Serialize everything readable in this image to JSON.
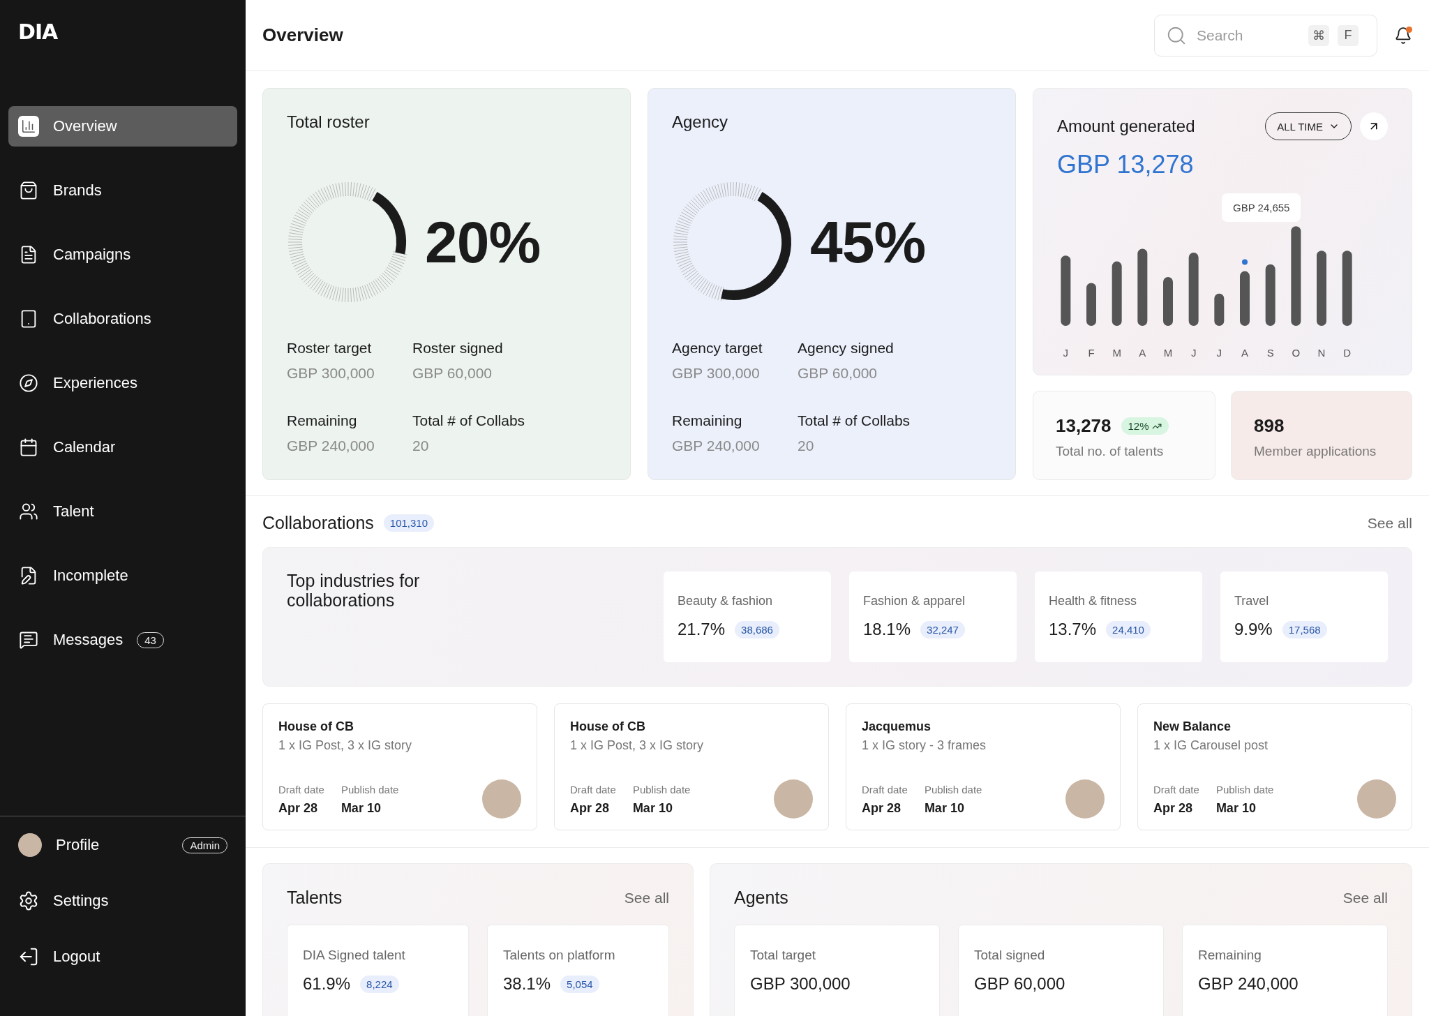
{
  "sidebar": {
    "logo": "DIA",
    "items": [
      {
        "label": "Overview",
        "selected": true
      },
      {
        "label": "Brands",
        "selected": false
      },
      {
        "label": "Campaigns",
        "selected": false
      },
      {
        "label": "Collaborations",
        "selected": false
      },
      {
        "label": "Experiences",
        "selected": false
      },
      {
        "label": "Calendar",
        "selected": false
      },
      {
        "label": "Talent",
        "selected": false
      },
      {
        "label": "Incomplete",
        "selected": false
      },
      {
        "label": "Messages",
        "selected": false,
        "badge": "43"
      }
    ],
    "footer": [
      {
        "kind": "profile",
        "label": "Profile",
        "badge": "Admin"
      },
      {
        "kind": "settings",
        "label": "Settings"
      },
      {
        "kind": "logout",
        "label": "Logout"
      }
    ]
  },
  "header": {
    "title": "Overview",
    "search": {
      "placeholder": "Search",
      "shortcut": [
        "⌘",
        "F"
      ]
    },
    "notification_dot": true
  },
  "roster_cards": [
    {
      "title": "Total roster",
      "percent": "20%",
      "level": 0.2,
      "stats": [
        {
          "label": "Roster target",
          "value": "GBP 300,000"
        },
        {
          "label": "Roster signed",
          "value": "GBP 60,000"
        },
        {
          "label": "Remaining",
          "value": "GBP 240,000"
        },
        {
          "label": "Total # of Collabs",
          "value": "20"
        }
      ]
    },
    {
      "title": "Agency",
      "percent": "45%",
      "level": 0.45,
      "stats": [
        {
          "label": "Agency target",
          "value": "GBP 300,000"
        },
        {
          "label": "Agency signed",
          "value": "GBP 60,000"
        },
        {
          "label": "Remaining",
          "value": "GBP 240,000"
        },
        {
          "label": "Total # of Collabs",
          "value": "20"
        }
      ]
    }
  ],
  "amount_card": {
    "title": "Amount generated",
    "filter": "ALL TIME",
    "total": "GBP 13,278",
    "tooltip": "GBP 24,655",
    "months": [
      {
        "label": "J",
        "highlighted": false
      },
      {
        "label": "F",
        "highlighted": false
      },
      {
        "label": "M",
        "highlighted": false
      },
      {
        "label": "A",
        "highlighted": false
      },
      {
        "label": "M",
        "highlighted": false
      },
      {
        "label": "J",
        "highlighted": false
      },
      {
        "label": "J",
        "highlighted": false
      },
      {
        "label": "A",
        "highlighted": true
      },
      {
        "label": "S",
        "highlighted": false
      },
      {
        "label": "O",
        "highlighted": false
      },
      {
        "label": "N",
        "highlighted": false
      },
      {
        "label": "D",
        "highlighted": false
      }
    ]
  },
  "talent_count": {
    "value": "13,278",
    "change": "12%",
    "label": "Total no. of talents"
  },
  "member_applications": {
    "value": "898",
    "label": "Member applications"
  },
  "collaborations": {
    "title": "Collaborations",
    "count": "101,310",
    "see_all": "See all",
    "industries_title": "Top industries for collaborations",
    "industries": [
      {
        "label": "Beauty & fashion",
        "value": "21.7%",
        "count": "38,686"
      },
      {
        "label": "Fashion & apparel",
        "value": "18.1%",
        "count": "32,247"
      },
      {
        "label": "Health & fitness",
        "value": "13.7%",
        "count": "24,410"
      },
      {
        "label": "Travel",
        "value": "9.9%",
        "count": "17,568"
      }
    ],
    "items": [
      {
        "brand": "House of CB",
        "deliverable": "1 x IG Post, 3 x IG story",
        "draft_label": "Draft date",
        "draft": "Apr 28",
        "publish_label": "Publish date",
        "publish": "Mar 10"
      },
      {
        "brand": "House of CB",
        "deliverable": "1 x IG Post, 3 x IG story",
        "draft_label": "Draft date",
        "draft": "Apr 28",
        "publish_label": "Publish date",
        "publish": "Mar 10"
      },
      {
        "brand": "Jacquemus",
        "deliverable": "1 x IG story - 3 frames",
        "draft_label": "Draft date",
        "draft": "Apr 28",
        "publish_label": "Publish date",
        "publish": "Mar 10"
      },
      {
        "brand": "New Balance",
        "deliverable": "1 x IG Carousel post",
        "draft_label": "Draft date",
        "draft": "Apr 28",
        "publish_label": "Publish date",
        "publish": "Mar 10"
      }
    ]
  },
  "talents": {
    "title": "Talents",
    "see_all": "See all",
    "stats": [
      {
        "label": "DIA Signed talent",
        "value": "61.9%",
        "count": "8,224"
      },
      {
        "label": "Talents on platform",
        "value": "38.1%",
        "count": "5,054"
      }
    ]
  },
  "agents": {
    "title": "Agents",
    "see_all": "See all",
    "stats": [
      {
        "label": "Total target",
        "value": "GBP 300,000"
      },
      {
        "label": "Total signed",
        "value": "GBP 60,000"
      },
      {
        "label": "Remaining",
        "value": "GBP 240,000"
      }
    ]
  }
}
